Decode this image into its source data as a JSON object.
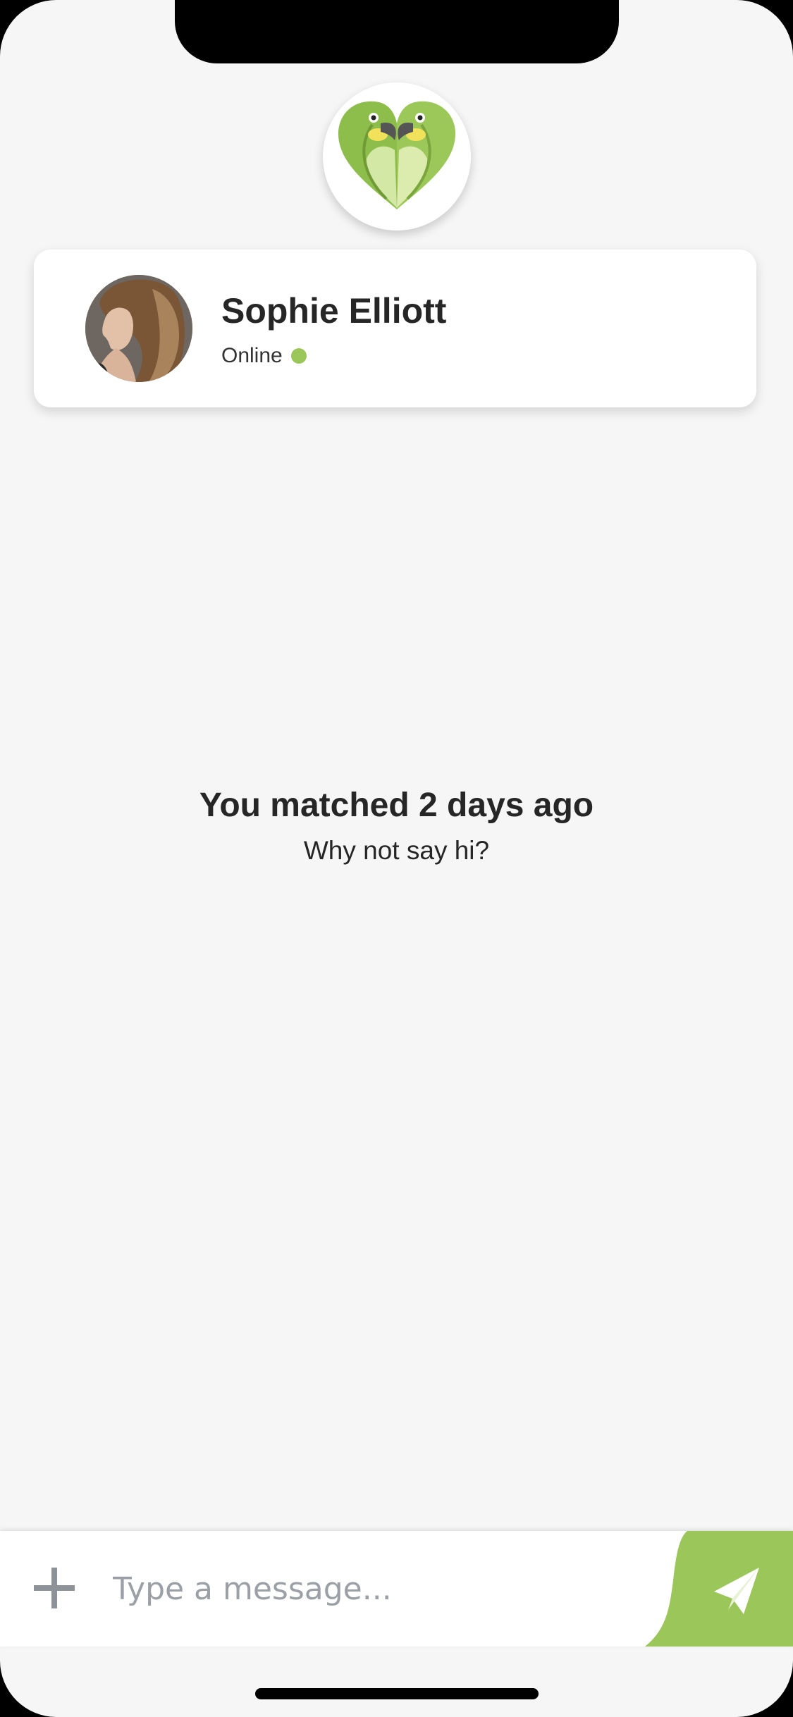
{
  "app": {
    "logo_icon": "parrot-heart-logo-icon"
  },
  "profile": {
    "name": "Sophie Elliott",
    "status": "Online",
    "status_color": "#9bc65a",
    "avatar_icon": "profile-photo"
  },
  "match": {
    "title": "You matched 2 days ago",
    "subtitle": "Why not say hi?"
  },
  "composer": {
    "placeholder": "Type a message...",
    "add_icon": "plus-icon",
    "send_icon": "send-icon"
  },
  "colors": {
    "accent": "#9bc65a",
    "background": "#f6f6f6",
    "text": "#262626",
    "placeholder": "#9aa0a6"
  }
}
